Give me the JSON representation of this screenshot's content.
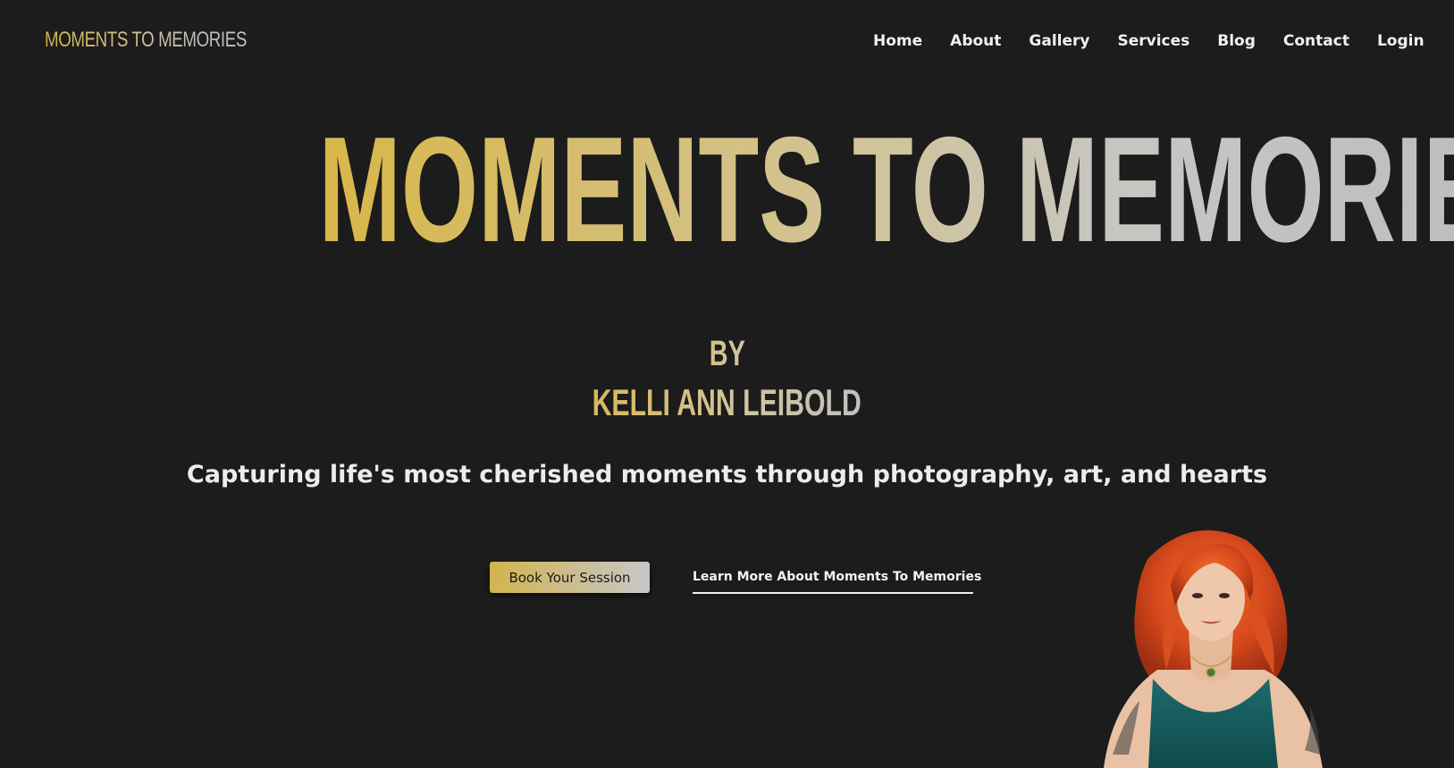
{
  "header": {
    "brand": "MOMENTS TO MEMORIES",
    "nav": [
      "Home",
      "About",
      "Gallery",
      "Services",
      "Blog",
      "Contact",
      "Login"
    ]
  },
  "hero": {
    "title": "MOMENTS TO MEMORIES",
    "by": "BY",
    "author": "KELLI ANN LEIBOLD",
    "tagline": "Capturing life's most cherished moments through photography, art, and hearts",
    "primary_button": "Book Your Session",
    "secondary_button": "Learn More About Moments To Memories"
  },
  "colors": {
    "background": "#1c1c1c",
    "gold": "#d4b44c",
    "silver": "#c0c0c0",
    "text": "#f0f0f0"
  }
}
